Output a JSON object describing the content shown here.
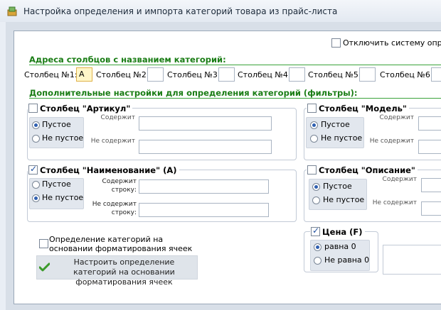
{
  "window": {
    "title": "Настройка определения и импорта категорий товара из прайс-листа"
  },
  "top_option": {
    "label": "Отключить систему опред",
    "checked": false
  },
  "addresses": {
    "title": "Адреса столбцов с названием категорий:",
    "columns": [
      {
        "label": "Столбец №1:",
        "value": "A"
      },
      {
        "label": "Столбец №2:",
        "value": ""
      },
      {
        "label": "Столбец №3:",
        "value": ""
      },
      {
        "label": "Столбец №4:",
        "value": ""
      },
      {
        "label": "Столбец №5:",
        "value": ""
      },
      {
        "label": "Столбец №6:",
        "value": ""
      }
    ]
  },
  "filters": {
    "title": "Дополнительные настройки для определения категорий (фильтры):",
    "groups": {
      "article": {
        "title": "Столбец \"Артикул\"",
        "checked": false,
        "options": [
          "Пустое",
          "Не пустое"
        ],
        "selected": 0,
        "contains_label": "Содержит",
        "not_contains_label": "Не содержит"
      },
      "model": {
        "title": "Столбец \"Модель\"",
        "checked": false,
        "options": [
          "Пустое",
          "Не пустое"
        ],
        "selected": 0,
        "contains_label": "Содержит",
        "not_contains_label": "Не содержит"
      },
      "name": {
        "title": "Столбец \"Наименование\" (А)",
        "checked": true,
        "options": [
          "Пустое",
          "Не пустое"
        ],
        "selected": 1,
        "contains_label": "Содержит строку:",
        "not_contains_label": "Не содержит строку:"
      },
      "description": {
        "title": "Столбец \"Описание\"",
        "checked": false,
        "options": [
          "Пустое",
          "Не пустое"
        ],
        "selected": 0,
        "contains_label": "Содержит",
        "not_contains_label": "Не содержит"
      },
      "price": {
        "title": "Цена (F)",
        "checked": true,
        "options": [
          "равна 0",
          "Не равна 0"
        ],
        "selected": 0
      }
    }
  },
  "formatting": {
    "checkbox_label": "Определение категорий на основании форматирования ячеек",
    "checked": false,
    "button_label": "Настроить определение категорий на основании форматирования ячеек"
  }
}
